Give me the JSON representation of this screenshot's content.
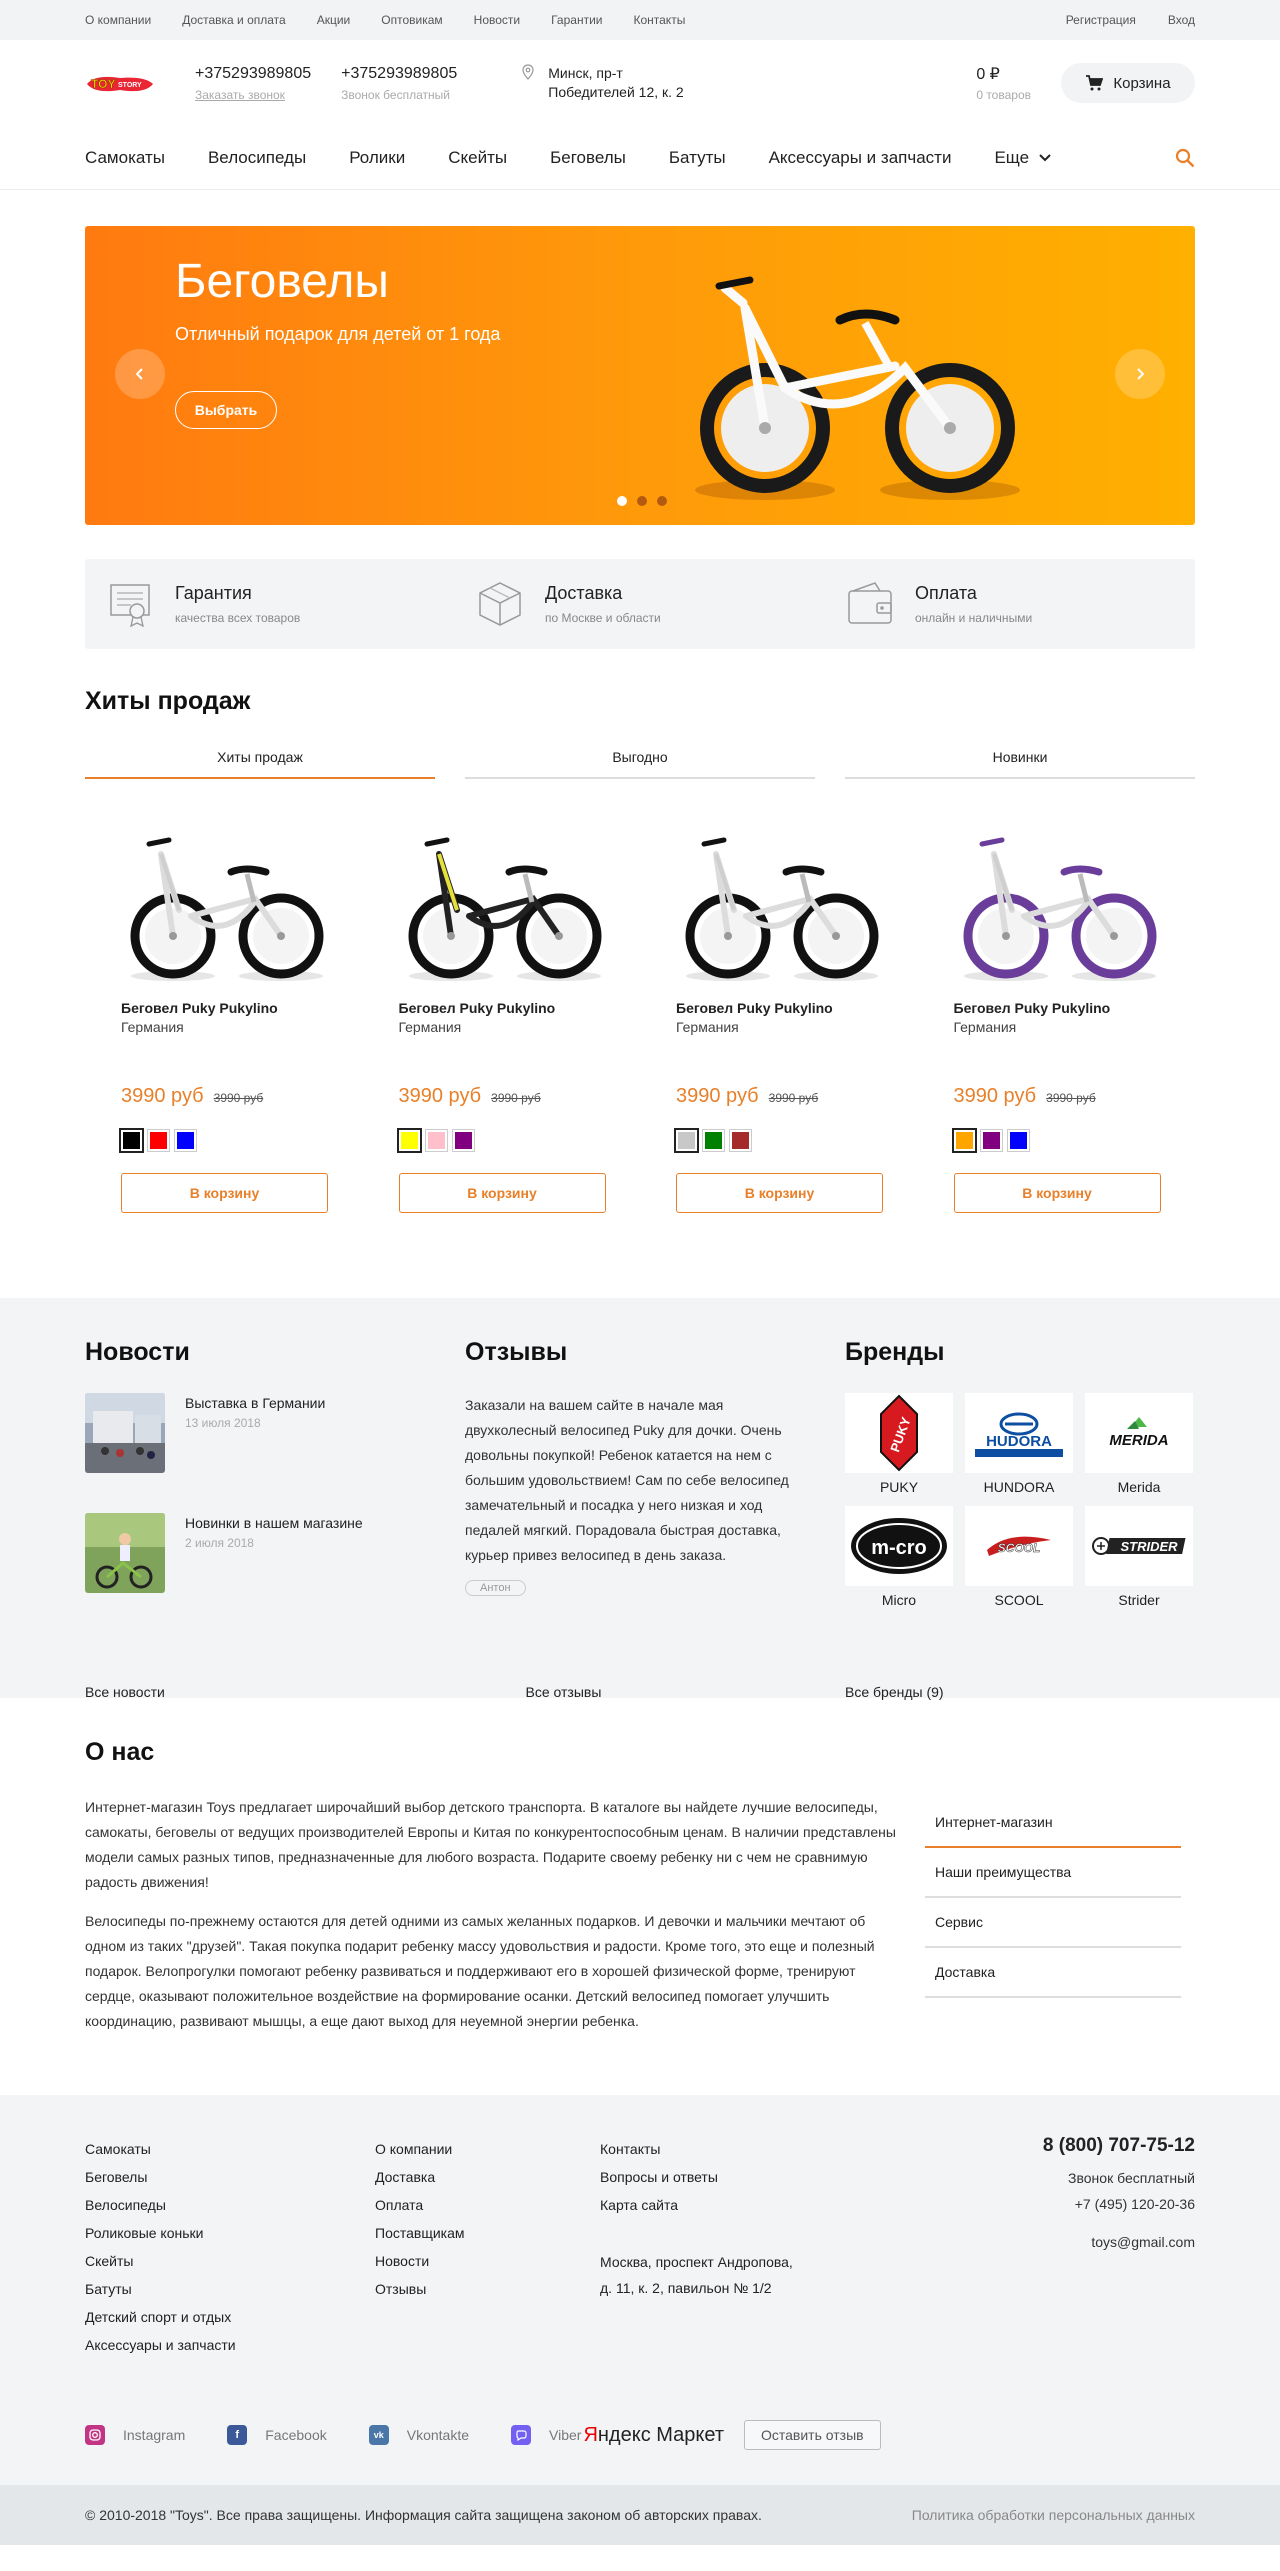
{
  "topbar": {
    "links": [
      "О компании",
      "Доставка и оплата",
      "Акции",
      "Оптовикам",
      "Новости",
      "Гарантии",
      "Контакты"
    ],
    "register": "Регистрация",
    "login": "Вход"
  },
  "header": {
    "logo_text": "TOY STORY",
    "phone1": "+375293989805",
    "phone1_sub": "Заказать звонок",
    "phone2": "+375293989805",
    "phone2_sub": "Звонок бесплатный",
    "address_line1": "Минск, пр-т",
    "address_line2": "Победителей 12, к. 2",
    "cart_sum": "0 ₽",
    "cart_count": "0 товаров",
    "cart_label": "Корзина"
  },
  "nav": {
    "items": [
      "Самокаты",
      "Велосипеды",
      "Ролики",
      "Скейты",
      "Беговелы",
      "Батуты",
      "Аксессуары и запчасти"
    ],
    "more": "Еще"
  },
  "slider": {
    "title": "Беговелы",
    "subtitle": "Отличный подарок для детей от 1 года",
    "button": "Выбрать",
    "active_slide": 1,
    "slide_count": 3
  },
  "features": [
    {
      "title": "Гарантия",
      "sub": "качества всех товаров",
      "icon": "certificate-icon"
    },
    {
      "title": "Доставка",
      "sub": "по Москве и области",
      "icon": "box-icon"
    },
    {
      "title": "Оплата",
      "sub": "онлайн и наличными",
      "icon": "wallet-icon"
    }
  ],
  "hits": {
    "title": "Хиты продаж",
    "tabs": [
      "Хиты продаж",
      "Выгодно",
      "Новинки"
    ],
    "active_tab": 0
  },
  "products": [
    {
      "name": "Беговел Puky Pukylino",
      "country": "Германия",
      "price": "3990 руб",
      "old_price": "3990 руб",
      "button": "В корзину",
      "colors": [
        "#000000",
        "#ff0000",
        "#0000ff"
      ],
      "selected": 0,
      "bike_frame": "#ffffff"
    },
    {
      "name": "Беговел Puky Pukylino",
      "country": "Германия",
      "price": "3990 руб",
      "old_price": "3990 руб",
      "button": "В корзину",
      "colors": [
        "#ffff00",
        "#ffc0cb",
        "#800080"
      ],
      "selected": 0,
      "bike_frame": "#222222"
    },
    {
      "name": "Беговел Puky Pukylino",
      "country": "Германия",
      "price": "3990 руб",
      "old_price": "3990 руб",
      "button": "В корзину",
      "colors": [
        "#c8c8c8",
        "#008000",
        "#a52a2a"
      ],
      "selected": 0,
      "bike_frame": "#ffffff"
    },
    {
      "name": "Беговел Puky Pukylino",
      "country": "Германия",
      "price": "3990 руб",
      "old_price": "3990 руб",
      "button": "В корзину",
      "colors": [
        "#ffa500",
        "#800080",
        "#0000ff"
      ],
      "selected": 0,
      "bike_frame": "#f3f3f8"
    }
  ],
  "news": {
    "title": "Новости",
    "items": [
      {
        "title": "Выставка в Германии",
        "date": "13 июля 2018"
      },
      {
        "title": "Новинки в нашем магазине",
        "date": "2 июля 2018"
      }
    ],
    "all": "Все новости"
  },
  "reviews": {
    "title": "Отзывы",
    "text": "Заказали на вашем сайте в начале мая двухколесный велосипед Puky для дочки. Очень довольны покупкой! Ребенок катается на нем с большим удовольствием! Сам по себе велосипед замечательный и посадка у него низкая и ход педалей мягкий. Порадовала быстрая доставка, курьер привез велосипед в день заказа.",
    "author": "Антон",
    "all": "Все отзывы"
  },
  "brands": {
    "title": "Бренды",
    "items": [
      "PUKY",
      "HUNDORA",
      "Merida",
      "Micro",
      "SCOOL",
      "Strider"
    ],
    "all": "Все бренды (9)"
  },
  "about": {
    "title": "О нас",
    "p1": "Интернет-магазин Toys предлагает широчайший выбор детского транспорта. В каталоге вы найдете лучшие велосипеды, самокаты, беговелы от ведущих производителей Европы и Китая по конкурентоспособным ценам. В наличии представлены модели самых разных типов, предназначенные для любого возраста. Подарите своему ребенку ни с чем не сравнимую радость движения!",
    "p2": "Велосипеды по-прежнему остаются для детей одними из самых желанных подарков. И девочки и мальчики мечтают об одном из таких \"друзей\". Такая покупка подарит ребенку массу удовольствия и радости. Кроме того, это еще и полезный подарок. Велопрогулки помогают ребенку развиваться и поддерживают его в хорошей физической форме, тренируют сердце, оказывают положительное воздействие на формирование осанки. Детский велосипед помогает улучшить координацию, развивают мышцы, а еще дают выход для неуемной энергии ребенка.",
    "menu": [
      "Интернет-магазин",
      "Наши преимущества",
      "Сервис",
      "Доставка"
    ],
    "active_menu": 0
  },
  "footer": {
    "col1": [
      "Самокаты",
      "Беговелы",
      "Велосипеды",
      "Роликовые коньки",
      "Скейты",
      "Батуты",
      "Детский спорт и отдых",
      "Аксессуары и запчасти"
    ],
    "col2": [
      "О компании",
      "Доставка",
      "Оплата",
      "Поставщикам",
      "Новости",
      "Отзывы"
    ],
    "col3": [
      "Контакты",
      "Вопросы и ответы",
      "Карта сайта"
    ],
    "address_line1": "Москва, проспект Андропова,",
    "address_line2": "д. 11, к. 2, павильон № 1/2",
    "phone": "8 (800) 707-75-12",
    "phone_sub": "Звонок бесплатный",
    "phone2": "+7 (495) 120-20-36",
    "email": "toys@gmail.com",
    "social": [
      "Instagram",
      "Facebook",
      "Vkontakte",
      "Viber"
    ],
    "ymarket_y": "Я",
    "ymarket_rest": "ндекс Маркет",
    "review_button": "Оставить отзыв",
    "copyright": "© 2010-2018 \"Toys\". Все права защищены. Информация сайта защищена законом об авторских правах.",
    "policy": "Политика обработки персональных данных"
  },
  "colors": {
    "accent": "#e8802a",
    "gray_bg": "#f2f4f6"
  }
}
